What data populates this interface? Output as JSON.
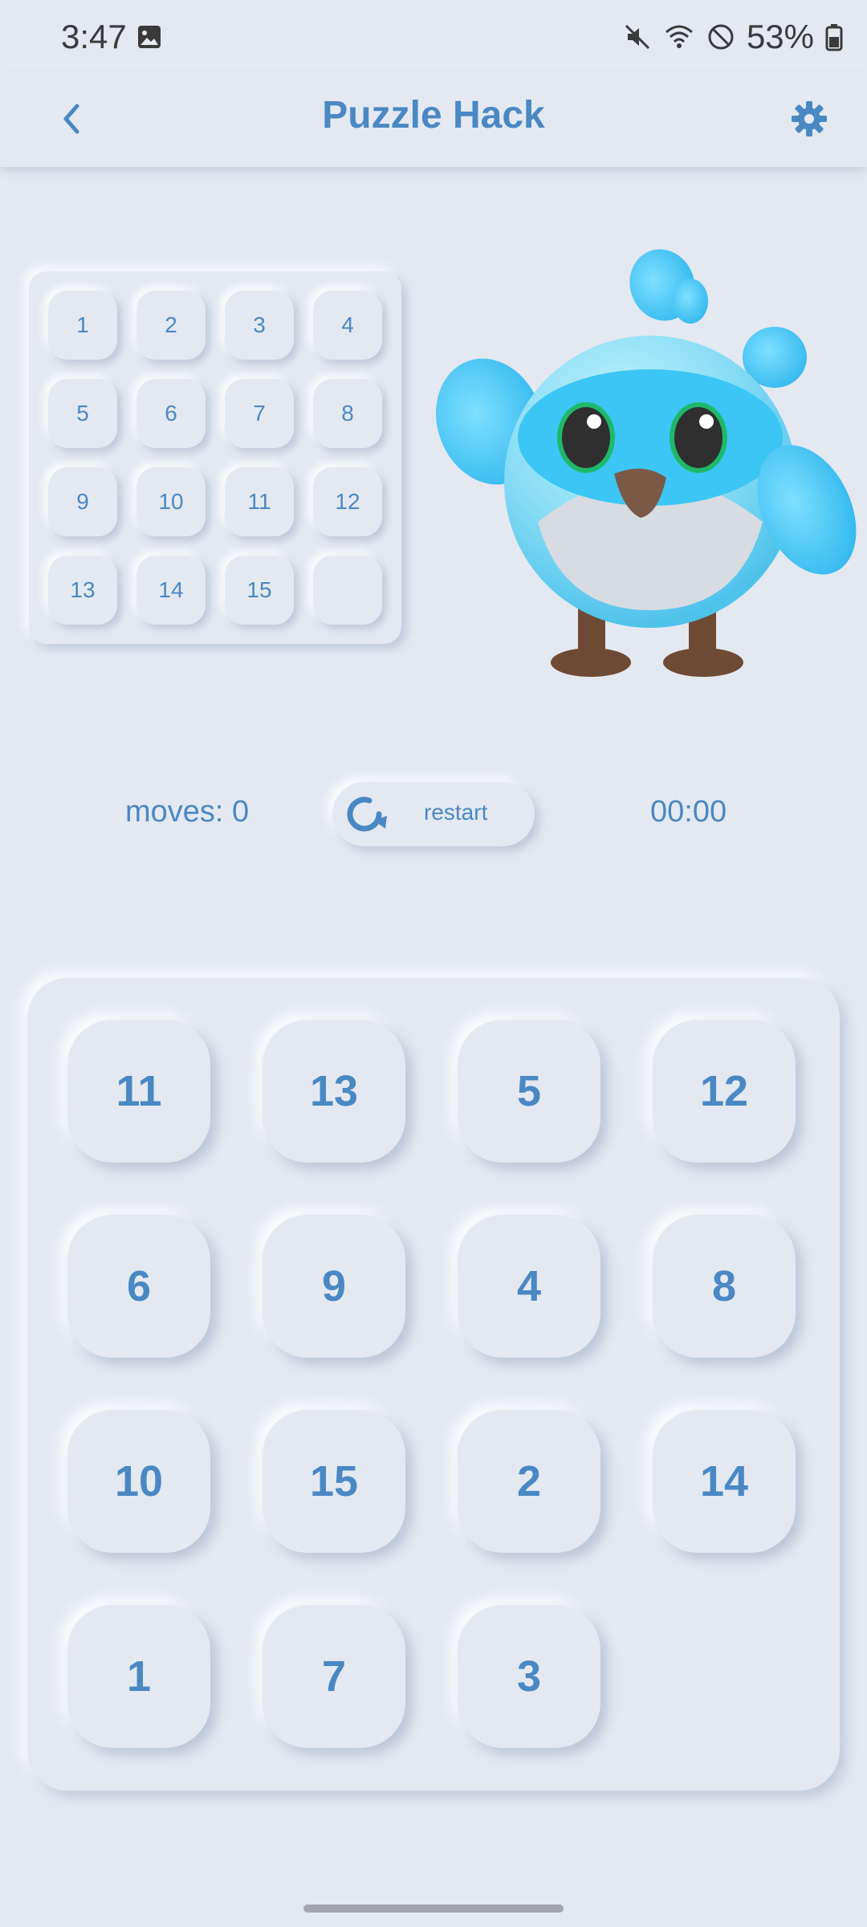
{
  "status_bar": {
    "time": "3:47",
    "battery": "53%",
    "icons": [
      "gallery-icon",
      "mute-icon",
      "wifi-icon",
      "do-not-disturb-icon",
      "battery-icon"
    ]
  },
  "app_bar": {
    "title": "Puzzle Hack",
    "back_icon": "chevron-left-icon",
    "settings_icon": "gear-icon"
  },
  "reference_board": {
    "tiles": [
      "1",
      "2",
      "3",
      "4",
      "5",
      "6",
      "7",
      "8",
      "9",
      "10",
      "11",
      "12",
      "13",
      "14",
      "15",
      ""
    ]
  },
  "controls": {
    "moves": "moves: 0",
    "restart_label": "restart",
    "timer": "00:00"
  },
  "board": {
    "tiles": [
      "11",
      "13",
      "5",
      "12",
      "6",
      "9",
      "4",
      "8",
      "10",
      "15",
      "2",
      "14",
      "1",
      "7",
      "3",
      ""
    ]
  },
  "colors": {
    "background": "#e4e9f1",
    "accent": "#4a88c4"
  }
}
